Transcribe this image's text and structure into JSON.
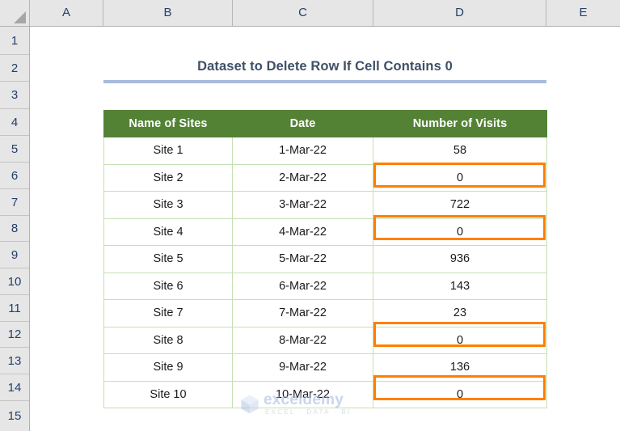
{
  "app": {
    "type": "spreadsheet",
    "select_all_icon": "select-all-triangle-icon"
  },
  "grid": {
    "column_headers": [
      "A",
      "B",
      "C",
      "D",
      "E"
    ],
    "row_headers": [
      "1",
      "2",
      "3",
      "4",
      "5",
      "6",
      "7",
      "8",
      "9",
      "10",
      "11",
      "12",
      "13",
      "14",
      "15"
    ]
  },
  "title": {
    "text": "Dataset to Delete Row If Cell Contains 0",
    "rule_color": "#a7bbdd",
    "text_color": "#3f5066"
  },
  "table": {
    "header_bg": "#548235",
    "header_text_color": "#ffffff",
    "border_color": "#c5e0b4",
    "columns": [
      "Name of Sites",
      "Date",
      "Number of Visits"
    ],
    "rows": [
      {
        "site": "Site 1",
        "date": "1-Mar-22",
        "visits": "58",
        "highlighted": false
      },
      {
        "site": "Site 2",
        "date": "2-Mar-22",
        "visits": "0",
        "highlighted": true
      },
      {
        "site": "Site 3",
        "date": "3-Mar-22",
        "visits": "722",
        "highlighted": false
      },
      {
        "site": "Site 4",
        "date": "4-Mar-22",
        "visits": "0",
        "highlighted": true
      },
      {
        "site": "Site 5",
        "date": "5-Mar-22",
        "visits": "936",
        "highlighted": false
      },
      {
        "site": "Site 6",
        "date": "6-Mar-22",
        "visits": "143",
        "highlighted": false
      },
      {
        "site": "Site 7",
        "date": "7-Mar-22",
        "visits": "23",
        "highlighted": false
      },
      {
        "site": "Site 8",
        "date": "8-Mar-22",
        "visits": "0",
        "highlighted": true
      },
      {
        "site": "Site 9",
        "date": "9-Mar-22",
        "visits": "136",
        "highlighted": false
      },
      {
        "site": "Site 10",
        "date": "10-Mar-22",
        "visits": "0",
        "highlighted": true
      }
    ],
    "highlight_color": "#ff7f00"
  },
  "watermark": {
    "name": "exceldemy",
    "tagline": "EXCEL  ·  DATA  ·  BI",
    "logo_icon": "hexagon-cube-logo-icon",
    "color": "#9db4dd"
  }
}
